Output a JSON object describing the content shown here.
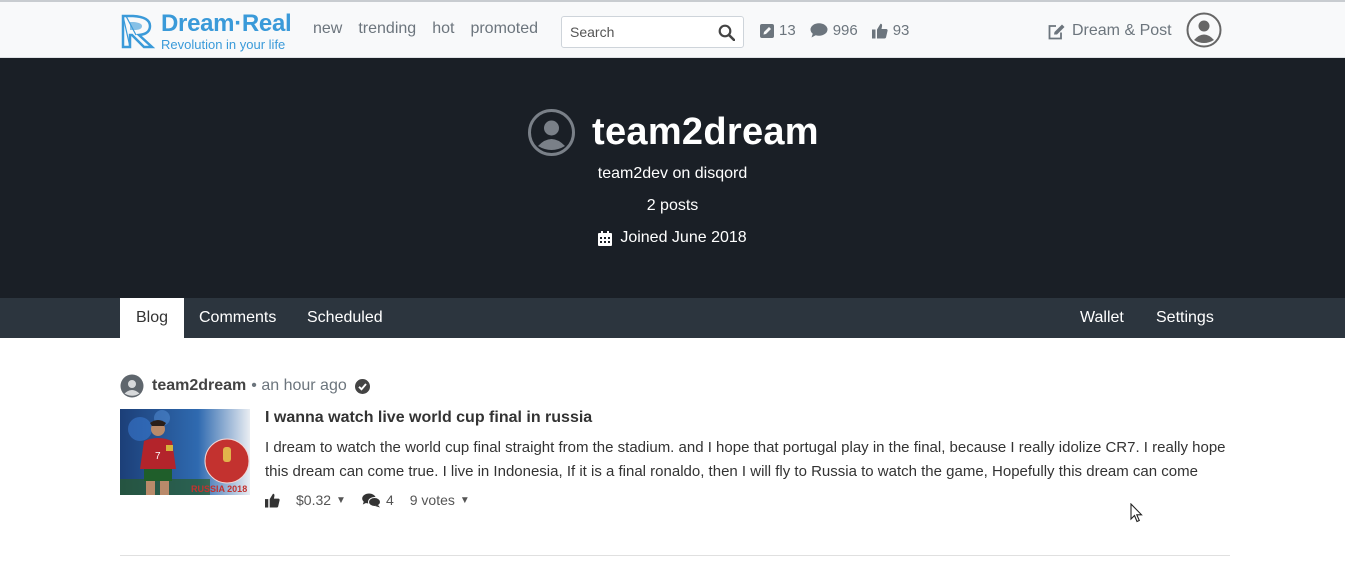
{
  "header": {
    "logo_title": "Dream·Real",
    "logo_subtitle": "Revolution in your life",
    "nav": [
      "new",
      "trending",
      "hot",
      "promoted"
    ],
    "search_placeholder": "Search",
    "stats": {
      "posts": "13",
      "comments": "996",
      "votes": "93"
    },
    "dream_post_label": "Dream & Post"
  },
  "profile": {
    "username": "team2dream",
    "about": "team2dev on disqord",
    "post_count": "2 posts",
    "joined": "Joined June 2018"
  },
  "tabs": {
    "left": [
      "Blog",
      "Comments",
      "Scheduled"
    ],
    "right": [
      "Wallet",
      "Settings"
    ],
    "active": "Blog"
  },
  "post": {
    "author": "team2dream",
    "time": "• an hour ago",
    "title": "I wanna watch live world cup final in russia",
    "body": "I dream to watch the world cup final straight from the stadium. and I hope that portugal play in the final, because I really idolize CR7. I really hope this dream can come true. I live in Indonesia, If it is a final ronaldo, then I will fly to Russia to watch the game, Hopefully this dream can come",
    "payout": "$0.32",
    "comments": "4",
    "votes": "9 votes",
    "thumbnail_text": "RUSSIA 2018"
  },
  "colors": {
    "brand": "#3a9ad9",
    "hero_bg": "#1a1f26",
    "subnav_bg": "#2c353e"
  }
}
